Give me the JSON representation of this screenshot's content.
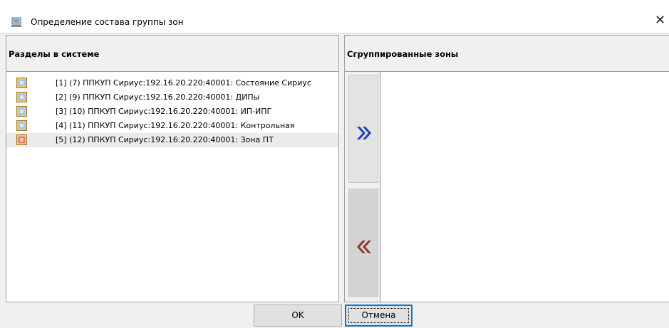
{
  "window": {
    "title": "Определение состава группы зон",
    "close_glyph": "✕",
    "icon": "app-window-icon"
  },
  "left_panel": {
    "header": "Разделы в системе",
    "items": [
      {
        "label": "[1] (7) ППКУП Сириус:192.16.20.220:40001: Состояние Сириус",
        "icon": "zone-icon",
        "selected": false
      },
      {
        "label": "[2] (9) ППКУП Сириус:192.16.20.220:40001: ДИПы",
        "icon": "zone-icon",
        "selected": false
      },
      {
        "label": "[3] (10) ППКУП Сириус:192.16.20.220:40001: ИП-ИПГ",
        "icon": "zone-icon",
        "selected": false
      },
      {
        "label": "[4] (11) ППКУП Сириус:192.16.20.220:40001: Контрольная",
        "icon": "zone-icon",
        "selected": false
      },
      {
        "label": "[5] (12) ППКУП Сириус:192.16.20.220:40001: Зона ПТ",
        "icon": "zone-fire-icon",
        "selected": true
      }
    ]
  },
  "right_panel": {
    "header": "Сгруппированные зоны",
    "items": []
  },
  "move_buttons": {
    "add_icon": "double-chevron-right-icon",
    "remove_icon": "double-chevron-left-icon",
    "add_color": "#1f3fb5",
    "remove_color": "#8b3a2e"
  },
  "footer": {
    "ok_label": "OK",
    "cancel_label": "Отмена"
  },
  "colors": {
    "focus_border": "#0078d7",
    "selection_bg": "#ebebeb"
  }
}
